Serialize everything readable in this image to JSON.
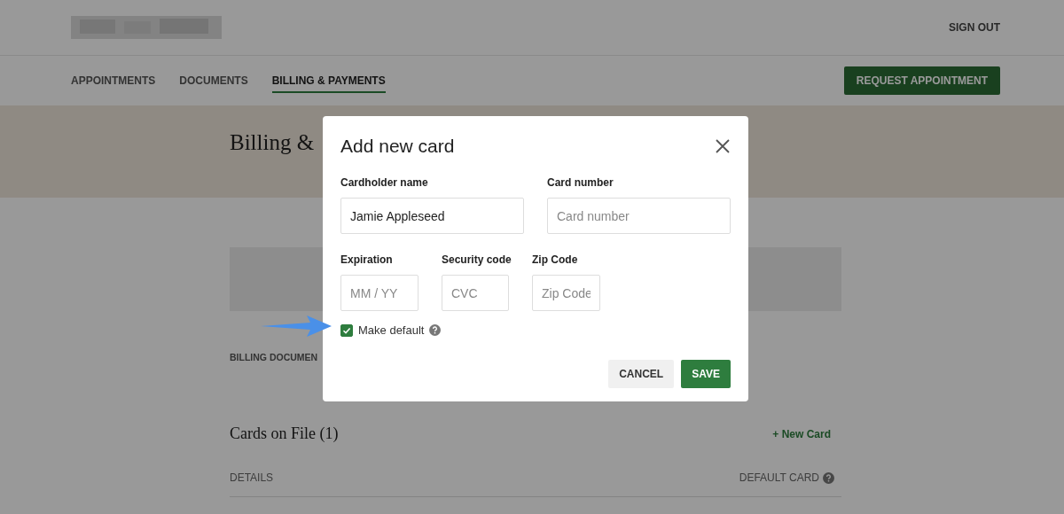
{
  "header": {
    "sign_out": "SIGN OUT"
  },
  "nav": {
    "tabs": [
      {
        "label": "APPOINTMENTS",
        "selected": false
      },
      {
        "label": "DOCUMENTS",
        "selected": false
      },
      {
        "label": "BILLING & PAYMENTS",
        "selected": true
      }
    ],
    "action": "REQUEST APPOINTMENT"
  },
  "page": {
    "title": "Billing &",
    "section_label": "BILLING DOCUMEN",
    "cards": {
      "title": "Cards on File (1)",
      "add": "+ New Card",
      "columns": [
        "DETAILS",
        "DEFAULT CARD"
      ]
    }
  },
  "dialog": {
    "title": "Add new card",
    "field_rows": [
      [
        {
          "label": "Cardholder name",
          "value": "Jamie Appleseed"
        },
        {
          "label": "Card number",
          "placeholder": "Card number"
        }
      ],
      [
        {
          "label": "Expiration",
          "placeholder": "MM / YY"
        },
        {
          "label": "Security code",
          "placeholder": "CVC"
        },
        {
          "label": "Zip Code",
          "placeholder": "Zip Code"
        }
      ]
    ],
    "make_default": {
      "label": "Make default",
      "checked": true
    },
    "buttons": [
      {
        "label": "CANCEL",
        "kind": "secondary"
      },
      {
        "label": "SAVE",
        "kind": "primary"
      }
    ]
  }
}
